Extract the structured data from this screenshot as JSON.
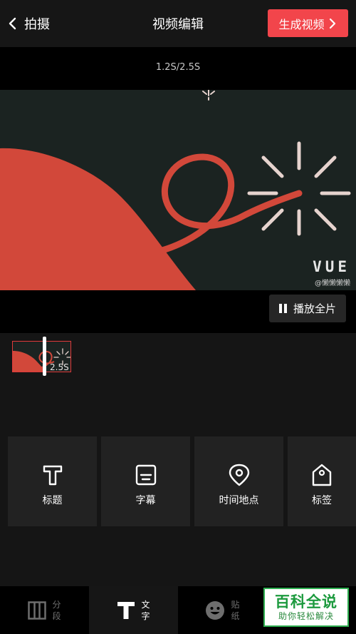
{
  "header": {
    "back_label": "拍摄",
    "title": "视频编辑",
    "generate_label": "生成视频"
  },
  "player": {
    "time_readout": "1.2S/2.5S",
    "preview_logo_text": "VUE",
    "preview_watermark": "@懒懒懒懒",
    "play_label": "播放全片"
  },
  "timeline": {
    "clip_duration": "2.5S"
  },
  "tools": [
    {
      "label": "标题",
      "icon": "text-t-icon"
    },
    {
      "label": "字幕",
      "icon": "subtitle-icon"
    },
    {
      "label": "时间地点",
      "icon": "location-pin-icon"
    },
    {
      "label": "标签",
      "icon": "tag-icon"
    }
  ],
  "tabs": [
    {
      "line1": "分",
      "line2": "段",
      "icon": "segments-icon"
    },
    {
      "line1": "文",
      "line2": "字",
      "icon": "text-t-icon",
      "active": true
    },
    {
      "line1": "贴",
      "line2": "纸",
      "icon": "smiley-icon"
    }
  ],
  "brand": {
    "main": "百科全说",
    "sub": "助你轻松解决"
  },
  "colors": {
    "accent": "#f2454b",
    "preview_bg": "#1b2321",
    "shape_red": "#d2483a",
    "brand_green": "#1c9a3e"
  }
}
